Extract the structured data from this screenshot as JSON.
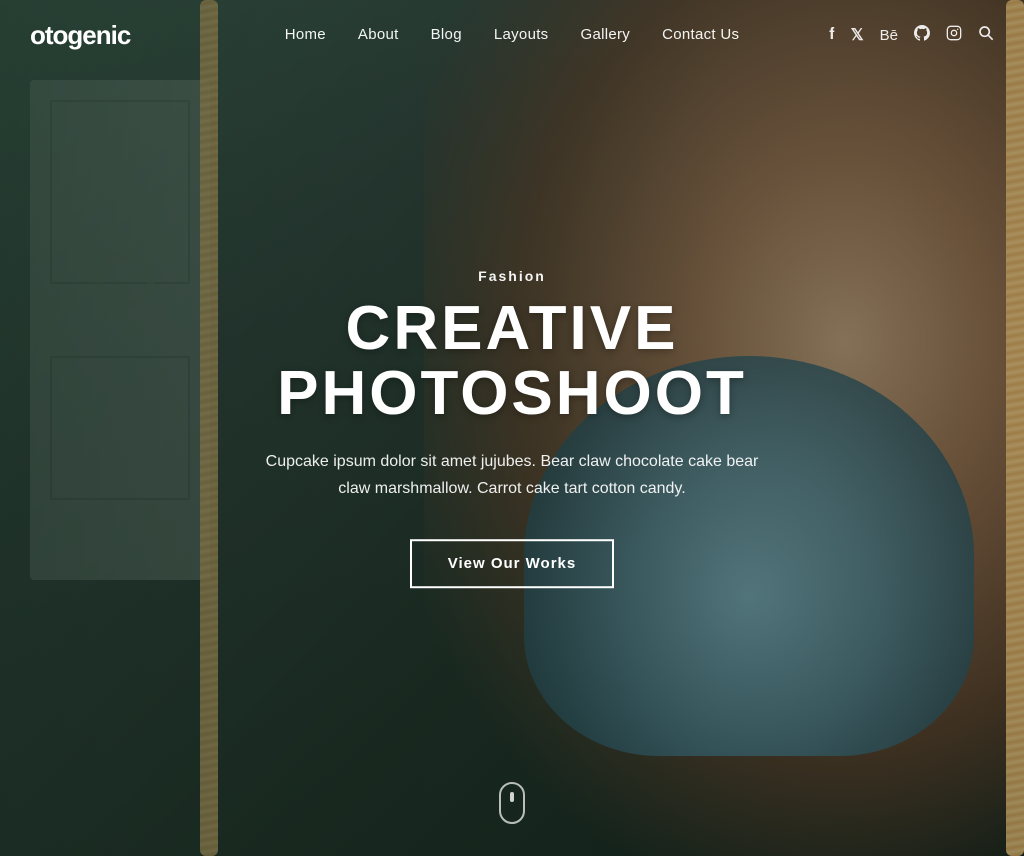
{
  "brand": {
    "logo": "otogenic",
    "logo_full": "Photogenic"
  },
  "navbar": {
    "items": [
      {
        "label": "Home",
        "id": "home"
      },
      {
        "label": "About",
        "id": "about"
      },
      {
        "label": "Blog",
        "id": "blog"
      },
      {
        "label": "Layouts",
        "id": "layouts"
      },
      {
        "label": "Gallery",
        "id": "gallery"
      },
      {
        "label": "Contact Us",
        "id": "contact"
      }
    ],
    "social": [
      {
        "icon": "f",
        "name": "facebook-icon",
        "label": "Facebook"
      },
      {
        "icon": "𝕏",
        "name": "twitter-icon",
        "label": "Twitter"
      },
      {
        "icon": "Bē",
        "name": "behance-icon",
        "label": "Behance"
      },
      {
        "icon": "⌥",
        "name": "github-icon",
        "label": "GitHub"
      },
      {
        "icon": "◻",
        "name": "instagram-icon",
        "label": "Instagram"
      },
      {
        "icon": "⌕",
        "name": "search-icon",
        "label": "Search"
      }
    ]
  },
  "hero": {
    "category": "Fashion",
    "title": "CREATIVE PHOTOSHOOT",
    "description": "Cupcake ipsum dolor sit amet jujubes. Bear claw chocolate cake bear claw marshmallow. Carrot cake tart cotton candy.",
    "cta_label": "View Our Works"
  },
  "colors": {
    "accent": "#ffffff",
    "overlay": "rgba(20,40,30,0.5)",
    "rope": "#c8a96e",
    "brand_green": "#2a3a35"
  }
}
